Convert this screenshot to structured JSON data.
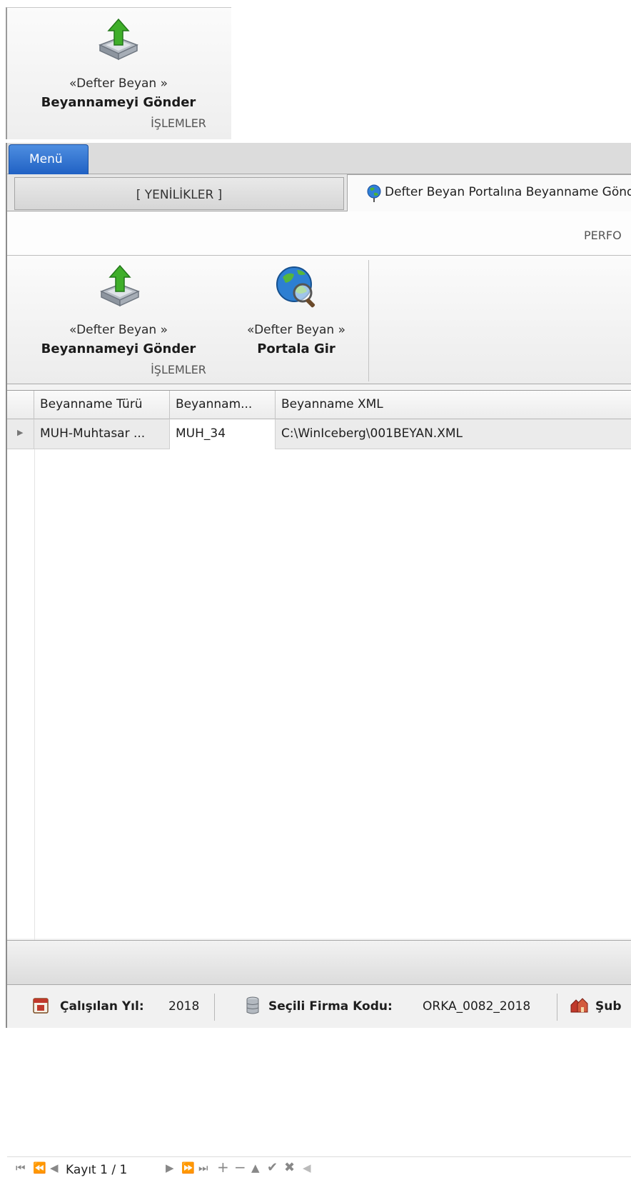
{
  "top_ribbon": {
    "caption_line1": "«Defter Beyan »",
    "caption_line2": "Beyannameyi Gönder",
    "group": "İŞLEMLER"
  },
  "menu": {
    "label": "Menü"
  },
  "tabs": [
    {
      "label": "[ YENİLİKLER ]"
    },
    {
      "label": "Defter Beyan Portalına Beyanname Gönder"
    }
  ],
  "perf_label": "PERFO",
  "ribbon": {
    "send": {
      "line1": "«Defter Beyan »",
      "line2": "Beyannameyi Gönder"
    },
    "portal": {
      "line1": "«Defter Beyan »",
      "line2": "Portala Gir"
    },
    "group": "İŞLEMLER"
  },
  "grid": {
    "columns": [
      "Beyanname Türü",
      "Beyannam...",
      "Beyanname XML"
    ],
    "rows": [
      [
        "MUH-Muhtasar ...",
        "MUH_34",
        "C:\\WinIceberg\\001BEYAN.XML"
      ]
    ]
  },
  "navigator": {
    "record_text": "Kayıt 1 / 1"
  },
  "status": {
    "year_label": "Çalışılan Yıl:",
    "year_value": "2018",
    "firm_label": "Seçili Firma Kodu:",
    "firm_value": "ORKA_0082_2018",
    "branch_label": "Şub"
  },
  "colors": {
    "menu_tab": "#2f72d4",
    "upload_arrow": "#3fae2a"
  }
}
